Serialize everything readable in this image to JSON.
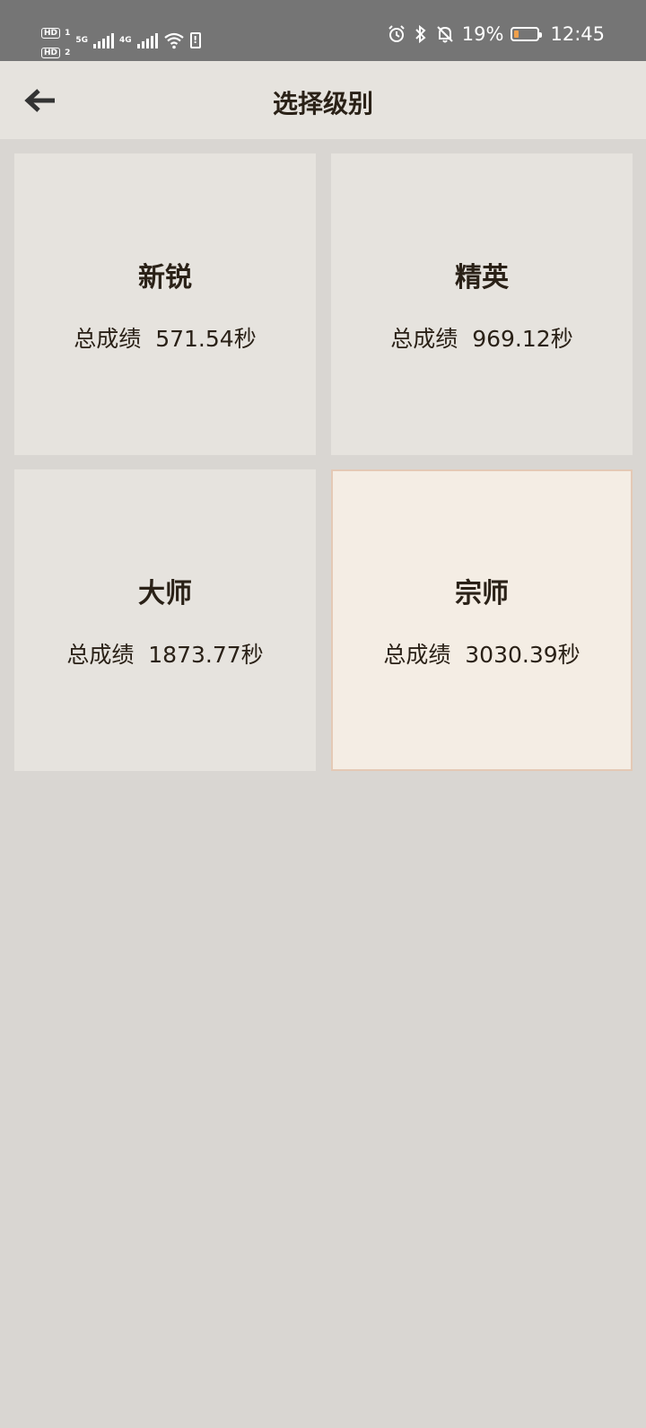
{
  "status_bar": {
    "hd1": "HD",
    "sim1": "1",
    "hd2": "HD",
    "sim2": "2",
    "network1": "5G",
    "network2": "4G",
    "battery_percent": "19%",
    "time": "12:45",
    "battery_level": 0.19,
    "icons": [
      "wifi-icon",
      "alarm-icon",
      "bluetooth-icon",
      "mute-icon",
      "battery-icon"
    ]
  },
  "app_bar": {
    "title": "选择级别",
    "back_icon": "arrow-left-icon"
  },
  "levels": [
    {
      "name": "新锐",
      "score_label": "总成绩",
      "score": "571.54秒",
      "selected": false
    },
    {
      "name": "精英",
      "score_label": "总成绩",
      "score": "969.12秒",
      "selected": false
    },
    {
      "name": "大师",
      "score_label": "总成绩",
      "score": "1873.77秒",
      "selected": false
    },
    {
      "name": "宗师",
      "score_label": "总成绩",
      "score": "3030.39秒",
      "selected": true
    }
  ],
  "colors": {
    "page_bg": "#d9d6d2",
    "card_bg": "#e6e3de",
    "selected_card_bg": "#f4ede4",
    "selected_border": "#e4c9b5",
    "text": "#2a2117",
    "status_bar_bg": "#757575"
  }
}
